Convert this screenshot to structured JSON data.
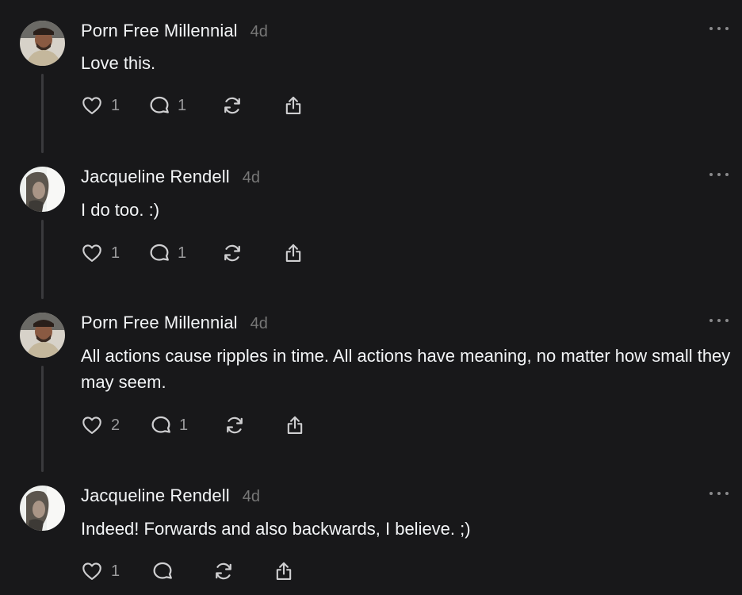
{
  "posts": [
    {
      "username": "Porn Free Millennial",
      "time": "4d",
      "text": "Love this.",
      "likes": "1",
      "replies": "1",
      "avatar": "bearded-man-avatar"
    },
    {
      "username": "Jacqueline Rendell",
      "time": "4d",
      "text": "I do too. :)",
      "likes": "1",
      "replies": "1",
      "avatar": "woman-avatar"
    },
    {
      "username": "Porn Free Millennial",
      "time": "4d",
      "text": "All actions cause ripples in time. All actions have meaning, no matter how small they may seem.",
      "likes": "2",
      "replies": "1",
      "avatar": "bearded-man-avatar"
    },
    {
      "username": "Jacqueline Rendell",
      "time": "4d",
      "text": "Indeed! Forwards and also backwards, I believe. ;)",
      "likes": "1",
      "replies": "",
      "avatar": "woman-avatar"
    }
  ],
  "icons": {
    "like": "heart-icon",
    "reply": "comment-icon",
    "repost": "repost-icon",
    "share": "share-icon",
    "more": "more-options-icon"
  },
  "colors": {
    "background": "#18181a",
    "text": "#f3f5f7",
    "muted": "#777777",
    "icon": "#cfcfd1"
  }
}
